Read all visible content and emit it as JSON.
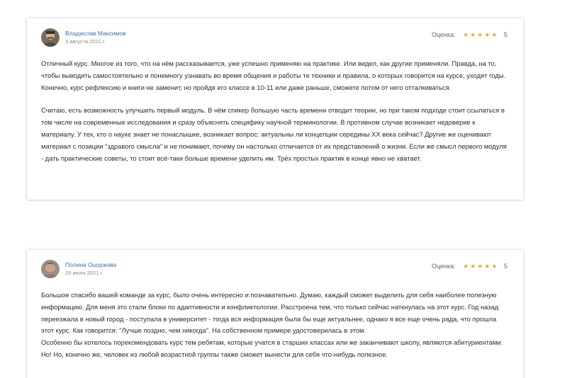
{
  "reviews": [
    {
      "author": "Владислав Максимов",
      "date": "3 августа 2021 г.",
      "rating_label": "Оценка:",
      "stars": "★★★★★",
      "rating_value": "5",
      "paragraphs": [
        "Отличный курс. Многое из того, что на нём рассказывается, уже успешно применяю на практике. Или видел, как другие применяли. Правда, на то, чтобы выводить самостоятельно и понемногу узнавать во время общения и работы те техники и правила, о которых говорится на курсе, уходят годы. Конечно, курс рефлексию и книги не заменит, но пройдя его классе в 10-11 или даже раньше, сможете потом от него отталкиваться.",
        "Считаю, есть возможность улучшить первый модуль. В нём спикер большую часть времени отводит теории, но при таком подходе стоит ссылаться в том числе на современные исследования и сразу объяснять специфику научной терминологии. В противном случае возникает недоверие к материалу. У тех, кто о науке знает не понаслышке, возникает вопрос: актуальны ли концепции середины XX века сейчас? Другие же оценивают материал с позиции \"здравого смысла\" и не понимают, почему он настолько отличается от их представлений о жизни. Если же смысл первого модуля - дать практические советы, то стоит всё-таки больше времени уделить им. Трёх простых практик в конце явно не хватает."
      ]
    },
    {
      "author": "Полина Ошуркова",
      "date": "29 июля 2021 г.",
      "rating_label": "Оценка:",
      "stars": "★★★★★",
      "rating_value": "5",
      "paragraphs": [
        "Большое спасибо вашей команде за курс, было очень интересно и познавательно. Думаю, каждый сможет выделить для себя наиболее полезную информацию. Для меня это стали блоки по адаптивности и конфликтологии. Расстроена тем, что только сейчас наткнулась на этот курс. Год назад переезжала в новый город - поступала в университет - тогда вся информация была бы еще актуальнее, однако я все еще очень рада, что прошла этот курс. Как говорится: \"Лучше поздно, чем никогда\". На собственном примере удостоверилась в этом.",
        "Особенно бы хотелось порекомендовать курс тем ребятам, которые учатся в старших классах или же заканчивают школу, являются абитуриентами. Но! Но, конечно же, человек из любой возрастной группы также сможет вынести для себя что-нибудь полезное."
      ]
    }
  ],
  "colors": {
    "author_link": "#3a6fb0",
    "star": "#f0a830",
    "text": "#2b2b2b",
    "muted": "#888888"
  }
}
